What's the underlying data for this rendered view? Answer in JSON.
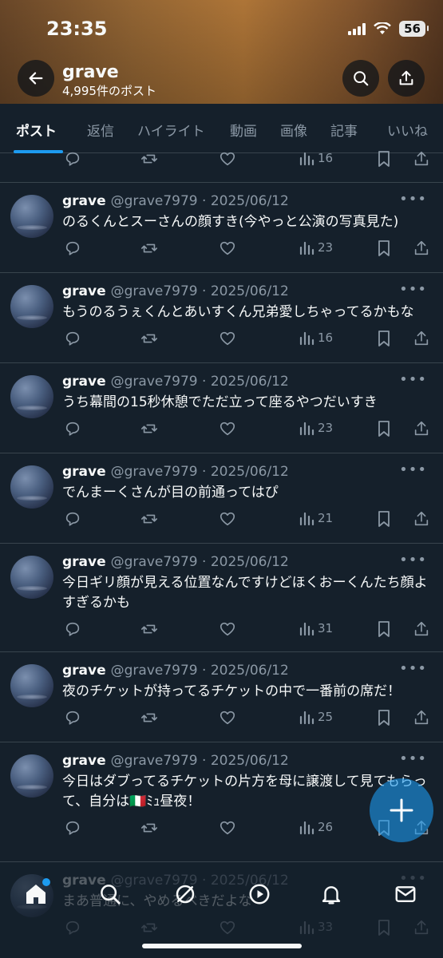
{
  "status_bar": {
    "time": "23:35",
    "battery": "56"
  },
  "header": {
    "title": "grave",
    "subtitle": "4,995件のポスト"
  },
  "tabs": [
    "ポスト",
    "返信",
    "ハイライト",
    "動画",
    "画像",
    "記事",
    "いいね"
  ],
  "partial_top_post": {
    "views": "16"
  },
  "posts": [
    {
      "name": "grave",
      "handle": "@grave7979 · 2025/06/12",
      "text": "のるくんとスーさんの顔すき(今やっと公演の写真見た)",
      "views": "23"
    },
    {
      "name": "grave",
      "handle": "@grave7979 · 2025/06/12",
      "text": "もうのるうぇくんとあいすくん兄弟愛しちゃってるかもな",
      "views": "16"
    },
    {
      "name": "grave",
      "handle": "@grave7979 · 2025/06/12",
      "text": "うち幕間の15秒休憩でただ立って座るやつだいすき",
      "views": "23"
    },
    {
      "name": "grave",
      "handle": "@grave7979 · 2025/06/12",
      "text": "でんまーくさんが目の前通ってはぴ",
      "views": "21"
    },
    {
      "name": "grave",
      "handle": "@grave7979 · 2025/06/12",
      "text": "今日ギリ顔が見える位置なんですけどほくおーくんたち顔よすぎるかも",
      "views": "31"
    },
    {
      "name": "grave",
      "handle": "@grave7979 · 2025/06/12",
      "text": "夜のチケットが持ってるチケットの中で一番前の席だ！",
      "views": "25"
    },
    {
      "name": "grave",
      "handle": "@grave7979 · 2025/06/12",
      "text": "今日はダブってるチケットの片方を母に譲渡して見てもらって、自分は🇮🇹ﾐｭ昼夜！",
      "views": "26"
    },
    {
      "name": "grave",
      "handle": "@grave7979 · 2025/06/12",
      "text": "まあ普通に、やめるべきだよな",
      "views": "33"
    }
  ],
  "colors": {
    "accent": "#1d9bf0",
    "background": "#15202b",
    "muted": "#8b98a5",
    "divider": "#38444d"
  },
  "icons": {
    "back": "arrow-left-icon",
    "search": "search-icon",
    "share": "share-icon",
    "compose": "plus-icon"
  }
}
